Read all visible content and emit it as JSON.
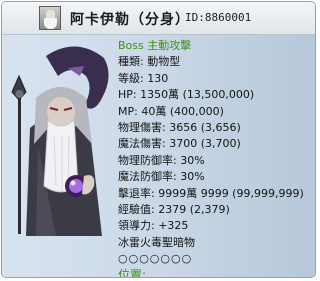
{
  "header": {
    "name": "阿卡伊勒（分身）",
    "id": "ID:8860001"
  },
  "info": {
    "lines": [
      "Boss 主動攻擊",
      "種類: 動物型",
      "等級: 130",
      "HP: 1350萬 (13,500,000)",
      "MP: 40萬 (400,000)",
      "物理傷害: 3656 (3,656)",
      "魔法傷害: 3700 (3,700)",
      "物理防御率: 30%",
      "魔法防御率: 30%",
      "擊退率: 9999萬 9999 (99,999,999)",
      "經驗值: 2379 (2,379)",
      "領導力: +325",
      "冰雷火毒聖暗物",
      "○○○○○○○",
      "位置:"
    ]
  },
  "colors": {
    "accent_green": "#3f8f1a",
    "panel_blue": "#cfdcea",
    "border": "#8fa2b4"
  },
  "icons": {
    "portrait": "boss-portrait-icon",
    "art": "akayile-boss-art"
  }
}
